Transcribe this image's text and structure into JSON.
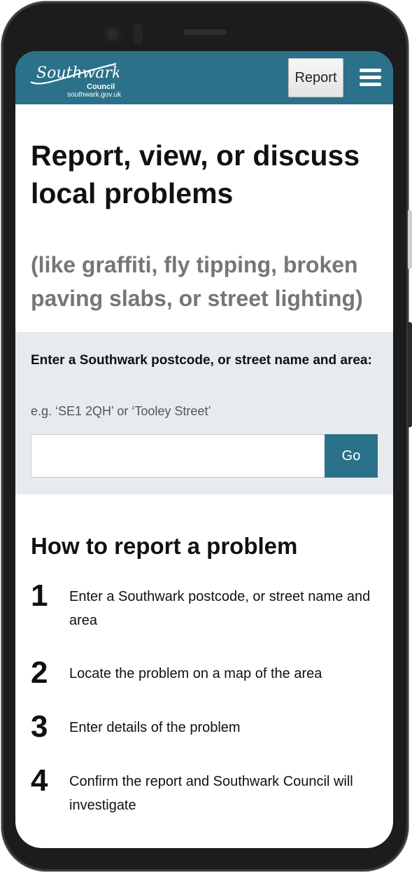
{
  "header": {
    "logo_script": "Southwark",
    "logo_council": "Council",
    "logo_url": "southwark.gov.uk",
    "report_button": "Report",
    "menu_icon": "hamburger-menu-icon"
  },
  "hero": {
    "title": "Report, view, or discuss local problems",
    "subtitle": "(like graffiti, fly tipping, broken paving slabs, or street lighting)"
  },
  "search": {
    "label": "Enter a Southwark postcode, or street name and area:",
    "hint": "e.g. ‘SE1 2QH’ or ‘Tooley Street’",
    "value": "",
    "go_button": "Go"
  },
  "howto": {
    "heading": "How to report a problem",
    "steps": [
      {
        "number": "1",
        "text": "Enter a Southwark postcode, or street name and area"
      },
      {
        "number": "2",
        "text": "Locate the problem on a map of the area"
      },
      {
        "number": "3",
        "text": "Enter details of the problem"
      },
      {
        "number": "4",
        "text": "Confirm the report and Southwark Council will investigate"
      }
    ]
  },
  "colors": {
    "brand": "#2a7189",
    "panel": "#e8ebee",
    "subtitle": "#767676"
  }
}
